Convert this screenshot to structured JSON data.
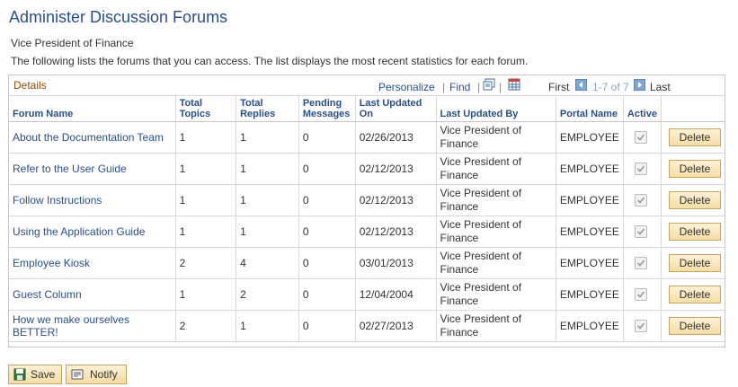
{
  "page": {
    "title": "Administer Discussion Forums",
    "subtitle": "Vice President of Finance",
    "description": "The following lists the forums that you can access. The list displays the most recent statistics for each forum."
  },
  "grid": {
    "caption": "Details",
    "personalize": "Personalize",
    "separator": "|",
    "find": "Find",
    "first": "First",
    "range": "1-7 of 7",
    "last": "Last",
    "columns": {
      "forum_name": "Forum Name",
      "total_topics": "Total Topics",
      "total_replies": "Total Replies",
      "pending": "Pending Messages",
      "last_updated_on": "Last Updated On",
      "last_updated_by": "Last Updated By",
      "portal_name": "Portal Name",
      "active": "Active"
    },
    "delete_label": "Delete",
    "rows": [
      {
        "forum_name": "About the Documentation Team",
        "total_topics": "1",
        "total_replies": "1",
        "pending": "0",
        "last_updated_on": "02/26/2013",
        "last_updated_by": "Vice President of Finance",
        "portal_name": "EMPLOYEE",
        "active": true
      },
      {
        "forum_name": "Refer to the User Guide",
        "total_topics": "1",
        "total_replies": "1",
        "pending": "0",
        "last_updated_on": "02/12/2013",
        "last_updated_by": "Vice President of Finance",
        "portal_name": "EMPLOYEE",
        "active": true
      },
      {
        "forum_name": "Follow Instructions",
        "total_topics": "1",
        "total_replies": "1",
        "pending": "0",
        "last_updated_on": "02/12/2013",
        "last_updated_by": "Vice President of Finance",
        "portal_name": "EMPLOYEE",
        "active": true
      },
      {
        "forum_name": "Using the Application Guide",
        "total_topics": "1",
        "total_replies": "1",
        "pending": "0",
        "last_updated_on": "02/12/2013",
        "last_updated_by": "Vice President of Finance",
        "portal_name": "EMPLOYEE",
        "active": true
      },
      {
        "forum_name": "Employee Kiosk",
        "total_topics": "2",
        "total_replies": "4",
        "pending": "0",
        "last_updated_on": "03/01/2013",
        "last_updated_by": "Vice President of Finance",
        "portal_name": "EMPLOYEE",
        "active": true
      },
      {
        "forum_name": "Guest Column",
        "total_topics": "1",
        "total_replies": "2",
        "pending": "0",
        "last_updated_on": "12/04/2004",
        "last_updated_by": "Vice President of Finance",
        "portal_name": "EMPLOYEE",
        "active": true
      },
      {
        "forum_name": "How we make ourselves BETTER!",
        "total_topics": "2",
        "total_replies": "1",
        "pending": "0",
        "last_updated_on": "02/27/2013",
        "last_updated_by": "Vice President of Finance",
        "portal_name": "EMPLOYEE",
        "active": true
      }
    ]
  },
  "actions": {
    "save_label": "Save",
    "notify_label": "Notify"
  },
  "icons": {
    "view_all": "view-all-icon",
    "download": "download-spreadsheet-icon",
    "prev": "previous-arrow-icon",
    "next": "next-arrow-icon",
    "save": "save-icon",
    "notify": "notify-icon"
  },
  "colors": {
    "title": "#2b4f86",
    "caption": "#8f4b0d",
    "button_top": "#fdf1d6",
    "button_bottom": "#f6dda6"
  }
}
